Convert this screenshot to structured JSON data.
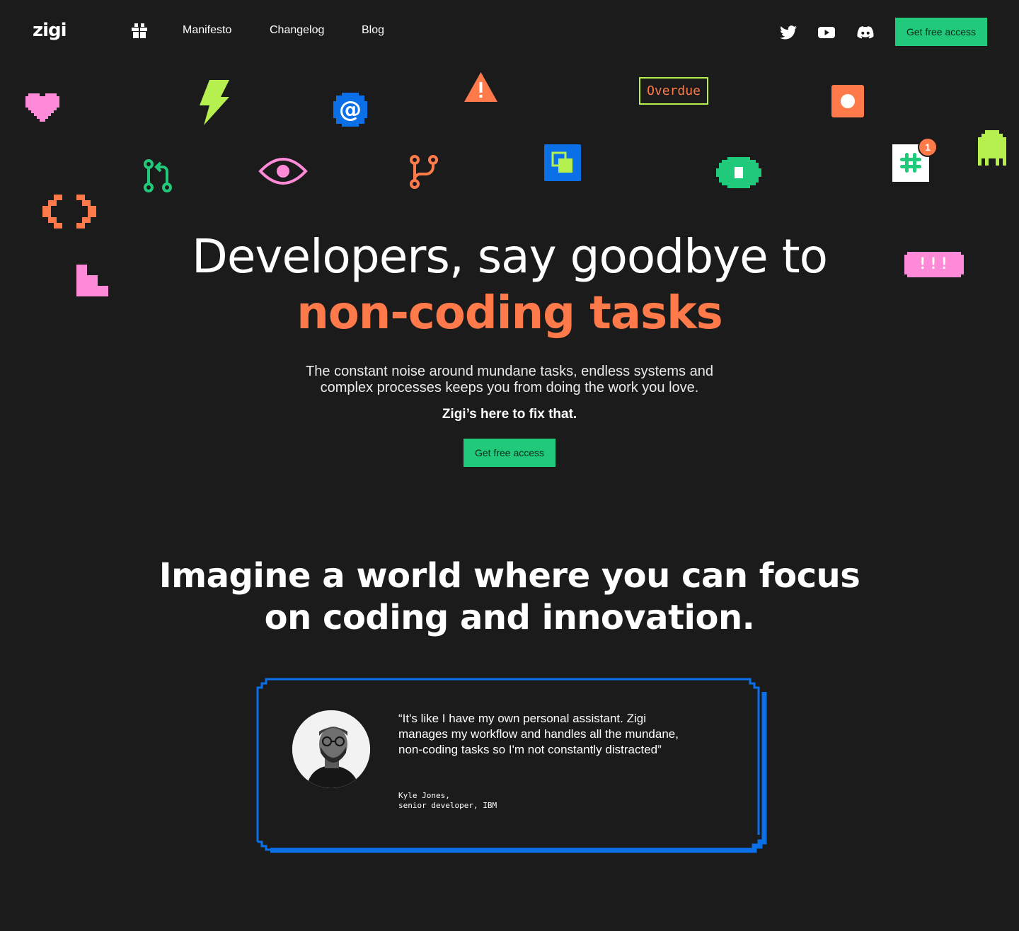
{
  "nav": {
    "logo": "zigi",
    "links": [
      "Manifesto",
      "Changelog",
      "Blog"
    ],
    "cta_label": "Get free access",
    "social_icons": [
      "twitter-icon",
      "youtube-icon",
      "discord-icon"
    ],
    "gift_icon": "gift-icon"
  },
  "decorations": {
    "overdue_badge": "Overdue",
    "bang_badge": "!!!",
    "notification_count": "1",
    "icons": [
      "heart-icon",
      "lightning-icon",
      "at-sign-icon",
      "warning-icon",
      "record-icon",
      "pull-request-icon",
      "eye-icon",
      "branch-icon",
      "copy-icon",
      "eye-pixel-icon",
      "slack-icon",
      "ghost-icon",
      "code-brackets-icon",
      "stairs-icon"
    ]
  },
  "hero": {
    "title_line1": "Developers, say goodbye to",
    "title_line2": "non-coding tasks",
    "subtitle": "The constant noise around mundane tasks, endless systems and complex processes keeps you from doing the work you love.",
    "fix_line": "Zigi’s here to fix that.",
    "cta_label": "Get free access"
  },
  "imagine": {
    "line1": "Imagine a world where you can focus",
    "line2": "on coding and innovation."
  },
  "testimonial": {
    "quote": "“It's like I have my own personal assistant. Zigi manages my workflow and handles all the mundane, non-coding tasks so I'm not constantly distracted”",
    "author_name": "Kyle Jones,",
    "author_role": "senior developer, IBM"
  },
  "colors": {
    "background": "#1b1b1b",
    "accent_green": "#21c97a",
    "accent_orange": "#ff7a4a",
    "accent_pink": "#ff8ad8",
    "accent_lime": "#b5f04f",
    "accent_blue": "#0b6fe8"
  }
}
